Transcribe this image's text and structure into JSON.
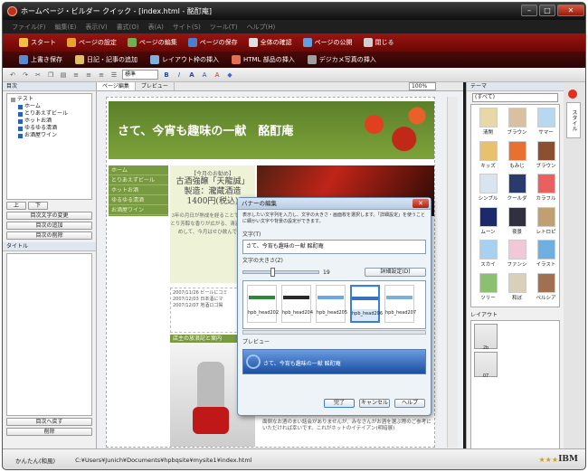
{
  "window": {
    "title": "ホームページ・ビルダー クイック - [index.html - 酩酊庵]"
  },
  "menu": [
    "ファイル(F)",
    "編集(E)",
    "表示(V)",
    "書式(O)",
    "表(A)",
    "サイト(S)",
    "ツール(T)",
    "ヘルプ(H)"
  ],
  "toolbar1": [
    "スタート",
    "ページの設定",
    "ページの編集",
    "ページの保存",
    "全体の確認",
    "ページの公開",
    "閉じる"
  ],
  "toolbar2": [
    "上書き保存",
    "日記・記事の追加",
    "レイアウト枠の挿入",
    "HTML 部品の挿入",
    "デジカメ写真の挿入"
  ],
  "format": {
    "font": "標準",
    "bold": "B",
    "italic": "I",
    "size_up": "A",
    "size_down": "A"
  },
  "left_pane": {
    "header": "目次",
    "tree": [
      "テスト",
      "ホーム",
      "とりあえずビール",
      "ホットお酒",
      "ゆるゆる清酒",
      "お酒屋ワイン"
    ],
    "buttons": [
      "上",
      "下",
      "目次文字の変更",
      "目次の追加",
      "目次の削除"
    ],
    "title_header": "タイトル",
    "bottom_buttons": [
      "目次へ戻す",
      "削除"
    ]
  },
  "editor": {
    "tabs": [
      "ページ編集",
      "プレビュー"
    ],
    "zoom": "100%",
    "banner_title": "さて、今宵も趣味の一献　酩酊庵",
    "nav": [
      "ホーム",
      "とりあえずビール",
      "ホットお酒",
      "ゆるゆる清酒",
      "お酒屋ワイン"
    ],
    "shop_small": "【今月のお勧め】",
    "shop_lines": [
      "古酒強醸「天龍誠」",
      "製造：瀧蔵酒造",
      "1400円(税込)"
    ],
    "shop_desc": "3年の月日が熟成を経ることで、しっとり芳醇な香りが広がる、清酒をお勧めして、今月はせひ飲んでね！",
    "news": [
      "2007/11/26 ビールにコミ",
      "2007/12/03 日本酒にマ",
      "2007/12/07 地酒ロゴ掲"
    ],
    "section2": "店主の放浪記と案内",
    "bottom_text": "面倒なお酒のまい話会がありませんが、みなさんがお酒を選ぶ際のご参考にいただければ幸いです。これがホットのイテイアン(明暗展)"
  },
  "right_pane": {
    "header": "テーマ",
    "filter": "(すべて)",
    "themes": [
      "清閑",
      "ブラウン",
      "サマー",
      "キッズ",
      "もみじ",
      "ブラウン",
      "シンプル",
      "クールダ",
      "カラフル",
      "ムーン",
      "夜景",
      "レトロピ",
      "スカイ",
      "ファンシ",
      "イラスト",
      "ツリー",
      "和ぼ",
      "ペルシア"
    ],
    "theme_colors": [
      "#e8d8a8",
      "#d8c0a0",
      "#b8d8f0",
      "#e8c070",
      "#e87030",
      "#8a5030",
      "#d8e4f0",
      "#2a3a6a",
      "#e86060",
      "#1a2a6a",
      "#303040",
      "#c0a070",
      "#a8d0f0",
      "#f0c8d8",
      "#70b0e0",
      "#8ac070",
      "#d8d0b8",
      "#a07050"
    ],
    "layout_header": "レイアウト",
    "layouts": [
      "2b",
      "07"
    ],
    "side_tab": "スタイル"
  },
  "status": {
    "mode": "かんたん(和風)",
    "path": "C:¥Users¥Junich¥Documents¥hpbqsite¥mysite1¥index.html",
    "brand": "IBM",
    "stars": "★★★"
  },
  "dialog": {
    "title": "バナーの編集",
    "desc": "表示したい文字列を入力し、文字の大きさ・画面枚を選択します。「詳細設定」を使うことに細かい文字や背景の設定ができます。",
    "text_label": "文字(T)",
    "text_value": "さて、今宵も趣味の一献 酩酊庵",
    "size_label": "文字の大きさ(Z)",
    "size_value": "19",
    "size_fraction": 0.38,
    "advanced": "詳細設定(D)",
    "thumbs": [
      "hpb_head202",
      "hpb_head204",
      "hpb_head205",
      "hpb_head206",
      "hpb_head207"
    ],
    "thumb_colors": [
      "#2a8a3a",
      "#2a2a2a",
      "#6aa8e8",
      "#3a70c0",
      "#7ab0e0"
    ],
    "selected_thumb": 3,
    "preview_label": "プレビュー",
    "preview_text": "さて、今宵も趣味の一献 酩酊庵",
    "buttons": [
      "完了",
      "キャンセル",
      "ヘルプ"
    ]
  }
}
